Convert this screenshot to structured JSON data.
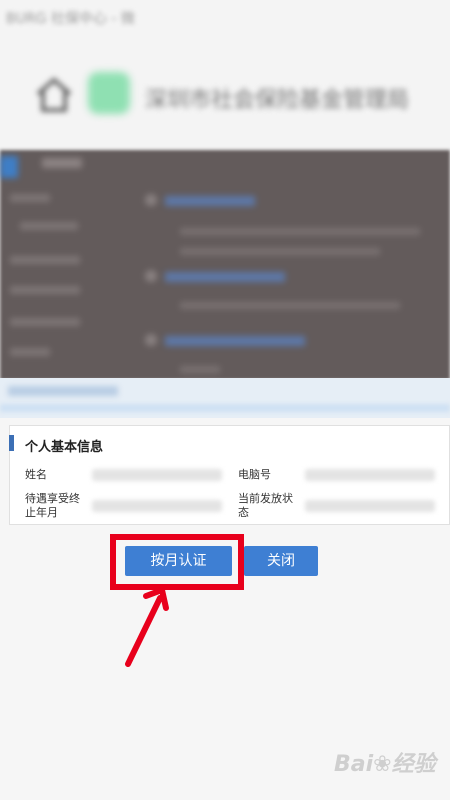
{
  "background": {
    "window_title": "BURG 社保中心 - 微",
    "site_name": "深圳市社会保险基金管理局"
  },
  "panel": {
    "title": "个人基本信息",
    "fields": [
      {
        "label": "姓名"
      },
      {
        "label": "电脑号"
      },
      {
        "label": "待遇享受终止年月"
      },
      {
        "label": "当前发放状态"
      }
    ]
  },
  "buttons": {
    "monthly_auth": "按月认证",
    "close": "关闭"
  },
  "watermark": {
    "text": "Bai",
    "suffix": "经验"
  },
  "colors": {
    "button_blue": "#3e7fd3",
    "highlight_red": "#e8001c",
    "panel_marker": "#3c6fb5"
  }
}
